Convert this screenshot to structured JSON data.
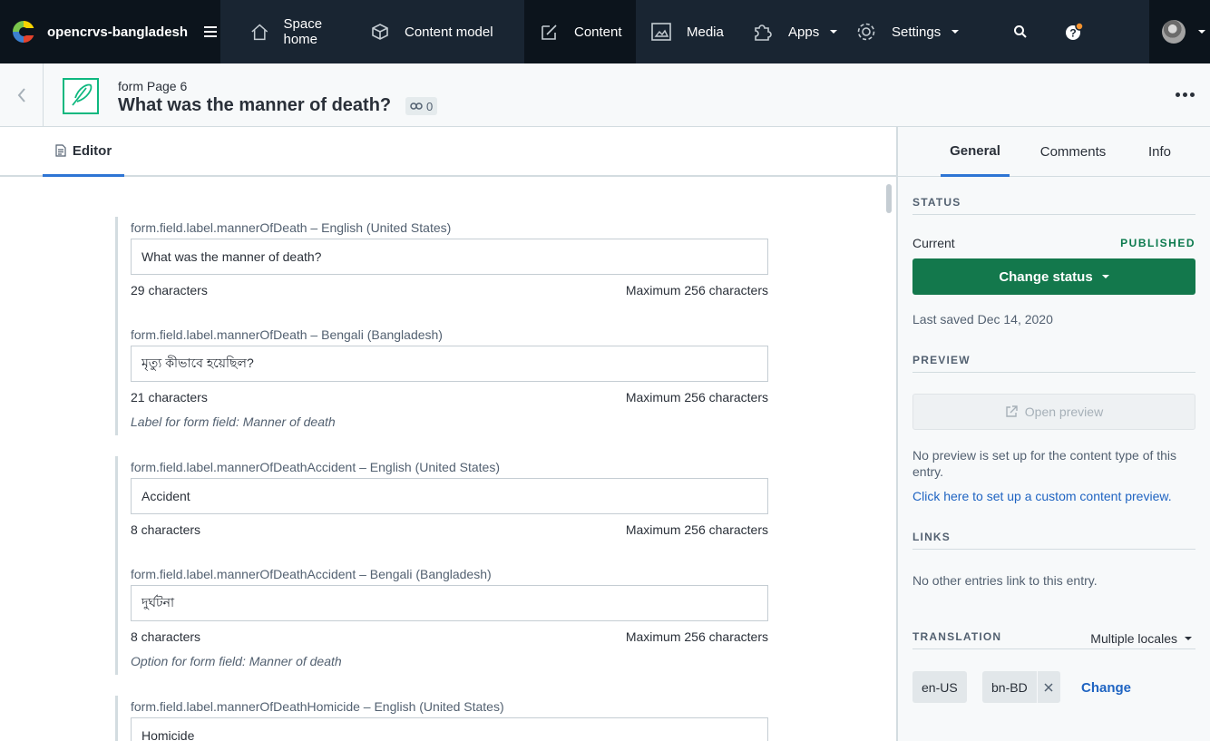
{
  "nav": {
    "space_name": "opencrvs-bangladesh",
    "items": [
      {
        "label": "Space home",
        "icon": "home-icon"
      },
      {
        "label": "Content model",
        "icon": "content-model-icon"
      },
      {
        "label": "Content",
        "icon": "content-icon",
        "active": true
      },
      {
        "label": "Media",
        "icon": "media-icon"
      },
      {
        "label": "Apps",
        "icon": "apps-icon"
      },
      {
        "label": "Settings",
        "icon": "settings-icon"
      }
    ],
    "notification_color": "#f5932e"
  },
  "entry": {
    "content_type": "form Page 6",
    "title": "What was the manner of death?",
    "reference_count": "0"
  },
  "editor": {
    "tab_label": "Editor",
    "groups": [
      {
        "fields": [
          {
            "label": "form.field.label.mannerOfDeath – English (United States)",
            "value": "What was the manner of death?",
            "count": "29 characters",
            "max": "Maximum 256 characters"
          },
          {
            "label": "form.field.label.mannerOfDeath – Bengali (Bangladesh)",
            "value": "মৃত্যু কীভাবে হয়েছিল?",
            "count": "21 characters",
            "max": "Maximum 256 characters"
          }
        ],
        "help": "Label for form field: Manner of death"
      },
      {
        "fields": [
          {
            "label": "form.field.label.mannerOfDeathAccident – English (United States)",
            "value": "Accident",
            "count": "8 characters",
            "max": "Maximum 256 characters"
          },
          {
            "label": "form.field.label.mannerOfDeathAccident – Bengali (Bangladesh)",
            "value": "দুর্ঘটনা",
            "count": "8 characters",
            "max": "Maximum 256 characters"
          }
        ],
        "help": "Option for form field: Manner of death"
      },
      {
        "fields": [
          {
            "label": "form.field.label.mannerOfDeathHomicide – English (United States)",
            "value": "Homicide"
          }
        ]
      }
    ]
  },
  "sidebar": {
    "tabs": [
      "General",
      "Comments",
      "Info"
    ],
    "status": {
      "title": "STATUS",
      "current_label": "Current",
      "current_value": "PUBLISHED",
      "button": "Change status",
      "last_saved": "Last saved Dec 14, 2020"
    },
    "preview": {
      "title": "PREVIEW",
      "button": "Open preview",
      "note": "No preview is set up for the content type of this entry.",
      "link": "Click here to set up a custom content preview."
    },
    "links": {
      "title": "LINKS",
      "note": "No other entries link to this entry."
    },
    "translation": {
      "title": "TRANSLATION",
      "dropdown": "Multiple locales",
      "locales": [
        "en-US",
        "bn-BD"
      ],
      "change": "Change"
    }
  }
}
